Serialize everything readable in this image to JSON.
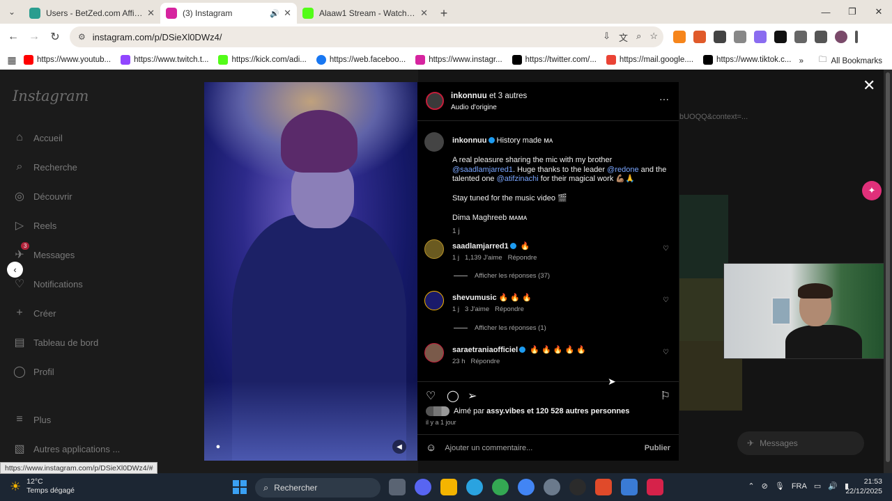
{
  "browser": {
    "tabs": [
      {
        "title": "Users - BetZed.com Affiliate",
        "color": "#2a9d8f"
      },
      {
        "title": "(3) Instagram",
        "color": "#d6249f"
      },
      {
        "title": "Alaaw1 Stream - Watch Live on",
        "color": "#53fc18"
      }
    ],
    "url": "instagram.com/p/DSieXl0DWz4/",
    "bookmarks": [
      {
        "label": "https://www.youtub...",
        "color": "#ff0000"
      },
      {
        "label": "https://www.twitch.t...",
        "color": "#9146ff"
      },
      {
        "label": "https://kick.com/adi...",
        "color": "#53fc18"
      },
      {
        "label": "https://web.faceboo...",
        "color": "#1877f2"
      },
      {
        "label": "https://www.instagr...",
        "color": "#d6249f"
      },
      {
        "label": "https://twitter.com/...",
        "color": "#000000"
      },
      {
        "label": "https://mail.google....",
        "color": "#ea4335"
      },
      {
        "label": "https://www.tiktok.c...",
        "color": "#000000"
      }
    ],
    "all_bookmarks": "All Bookmarks",
    "status_url": "https://www.instagram.com/p/DSieXl0DWz4/#"
  },
  "instagram": {
    "logo": "Instagram",
    "nav": {
      "home": "Accueil",
      "search": "Recherche",
      "explore": "Découvrir",
      "reels": "Reels",
      "messages": "Messages",
      "messages_badge": "3",
      "notifications": "Notifications",
      "create": "Créer",
      "dashboard": "Tableau de bord",
      "profile": "Profil",
      "more": "Plus",
      "other_apps": "Autres applications ..."
    },
    "bg_text": "bUOQQ&context=...",
    "messages_pill": "Messages",
    "post": {
      "header_user": "inkonnuu",
      "header_others": "et 3 autres",
      "header_audio": "Audio d'origine",
      "caption_user": "inkonnuu",
      "caption_title": "History made ᴍᴀ",
      "caption_p1_a": "A real pleasure sharing the mic with my brother",
      "caption_m1": "@saadlamjarred1",
      "caption_p1_b": ". Huge thanks to the leader",
      "caption_m2": "@redone",
      "caption_p1_c": "and the talented one",
      "caption_m3": "@atifzinachi",
      "caption_p1_d": "for their magical work 💪🏽🙏",
      "caption_p2": "Stay tuned for the music video 🎬",
      "caption_p3": "Dima Maghreeb ᴍᴀᴍᴀ",
      "caption_time": "1 j",
      "comments": [
        {
          "user": "saadlamjarred1",
          "text": "🔥",
          "time": "1 j",
          "likes": "1,139 J'aime",
          "reply": "Répondre",
          "replies": "Afficher les réponses (37)",
          "avatar": "#6a5a20"
        },
        {
          "user": "shevumusic",
          "text": "🔥 🔥 🔥",
          "time": "1 j",
          "likes": "3 J'aime",
          "reply": "Répondre",
          "replies": "Afficher les réponses (1)",
          "avatar": "#1a1a6a"
        },
        {
          "user": "saraetraniaofficiel",
          "text": "🔥 🔥 🔥 🔥 🔥",
          "time": "23 h",
          "likes": "",
          "reply": "Répondre",
          "replies": "",
          "avatar": "#7a5a4a"
        }
      ],
      "liked_by_prefix": "Aimé par",
      "liked_by_user": "assy.vibes",
      "liked_by_suffix": "et 120 528 autres personnes",
      "ago": "il y a 1 jour",
      "add_comment": "Ajouter un commentaire...",
      "publish": "Publier"
    }
  },
  "taskbar": {
    "temp": "12°C",
    "weather": "Temps dégagé",
    "search": "Rechercher",
    "lang": "FRA",
    "time": "21:53",
    "date": "22/12/2025"
  }
}
